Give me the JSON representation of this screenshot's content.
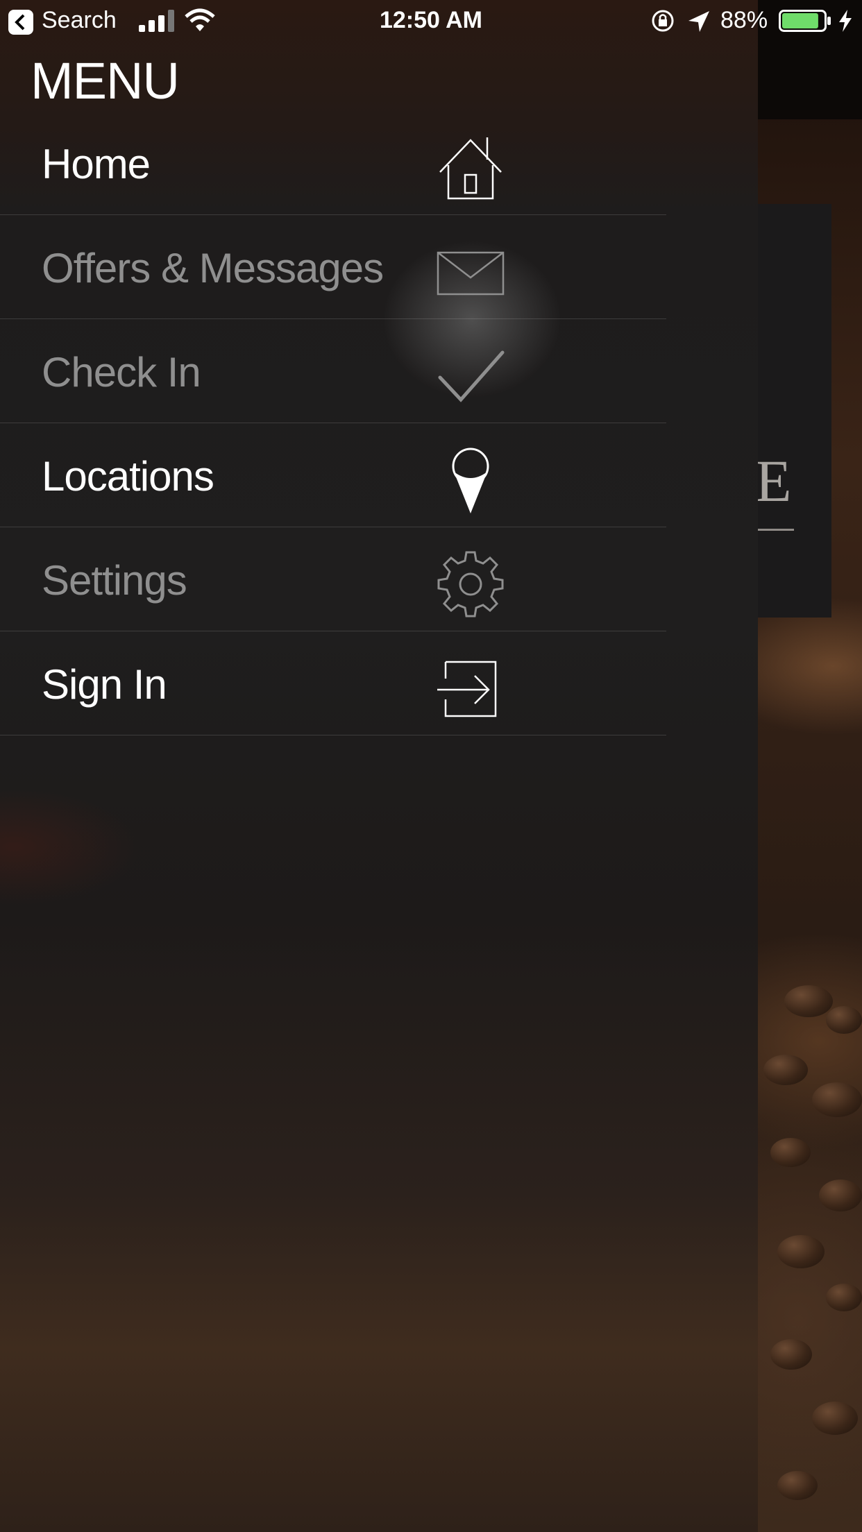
{
  "status_bar": {
    "back_label": "Search",
    "time": "12:50 AM",
    "battery_percent": "88%",
    "battery_level": 0.88
  },
  "menu": {
    "title": "MENU",
    "items": [
      {
        "label": "Home",
        "icon": "house-icon",
        "enabled": true
      },
      {
        "label": "Offers & Messages",
        "icon": "envelope-icon",
        "enabled": false
      },
      {
        "label": "Check In",
        "icon": "checkmark-icon",
        "enabled": false
      },
      {
        "label": "Locations",
        "icon": "map-pin-icon",
        "enabled": true
      },
      {
        "label": "Settings",
        "icon": "gear-icon",
        "enabled": false
      },
      {
        "label": "Sign In",
        "icon": "sign-in-icon",
        "enabled": true
      }
    ]
  },
  "background_app": {
    "partial_letter": "E"
  },
  "colors": {
    "enabled_text": "#ffffff",
    "disabled_text": "#8f8f8f",
    "battery_fill": "#6fdc6a"
  }
}
